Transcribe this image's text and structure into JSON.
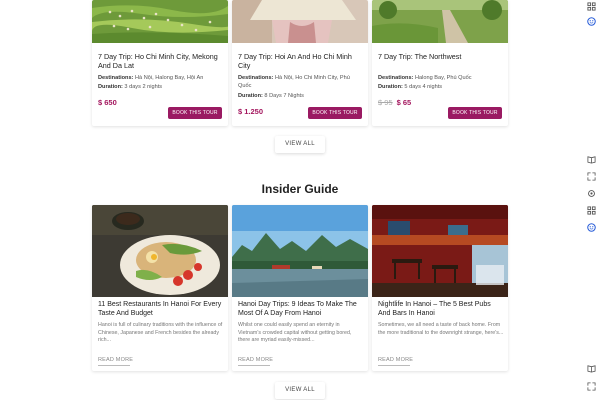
{
  "tours": [
    {
      "title": "7 Day Trip: Ho Chi Minh City, Mekong And Da Lat",
      "destinations_label": "Destinations:",
      "destinations": "Hà Nội, Halong Bay, Hội An",
      "duration_label": "Duration:",
      "duration": "3 days 2 nights",
      "old_price": "",
      "price": "$ 650",
      "button": "BOOK THIS TOUR",
      "image": "rice-terrace-photo"
    },
    {
      "title": "7 Day Trip: Hoi An And Ho Chi Minh City",
      "destinations_label": "Destinations:",
      "destinations": "Hà Nội, Ho Chi Minh City, Phú Quốc",
      "duration_label": "Duration:",
      "duration": "8 Days 7 Nights",
      "old_price": "",
      "price": "$ 1.250",
      "button": "BOOK THIS TOUR",
      "image": "conical-hat-photo"
    },
    {
      "title": "7 Day Trip: The Northwest",
      "destinations_label": "Destinations:",
      "destinations": "Halong Bay, Phú Quốc",
      "duration_label": "Duration:",
      "duration": "5 days 4 nights",
      "old_price": "$ 95",
      "price": "$ 65",
      "button": "BOOK THIS TOUR",
      "image": "countryside-path-photo"
    }
  ],
  "tours_view_all": "VIEW ALL",
  "guide_heading": "Insider Guide",
  "guides": [
    {
      "title": "11 Best Restaurants In Hanoi For Every Taste And Budget",
      "excerpt": "Hanoi is full of culinary traditions with the influence of Chinese, Japanese and French besides the already rich...",
      "read_more": "READ MORE",
      "image": "food-plate-photo"
    },
    {
      "title": "Hanoi Day Trips: 9 Ideas To Make The Most Of A Day From Hanoi",
      "excerpt": "Whilst one could easily spend an eternity in Vietnam's crowded capital without getting bored, there are myriad easily-missed...",
      "read_more": "READ MORE",
      "image": "river-karst-photo"
    },
    {
      "title": "Nightlife In Hanoi – The 5 Best Pubs And Bars In Hanoi",
      "excerpt": "Sometimes, we all need a taste of back home. From the more traditional to the downright strange, here's...",
      "read_more": "READ MORE",
      "image": "pub-interior-photo"
    }
  ],
  "guides_view_all": "VIEW ALL",
  "rail_icons": [
    "grid-icon",
    "smiley-icon",
    "book-icon",
    "expand-icon",
    "gear-icon",
    "grid-icon",
    "smiley-icon",
    "book-icon",
    "expand-icon"
  ],
  "colors": {
    "accent": "#9a1a62",
    "price": "#a3155d",
    "rail_blue": "#2b5fd9"
  }
}
